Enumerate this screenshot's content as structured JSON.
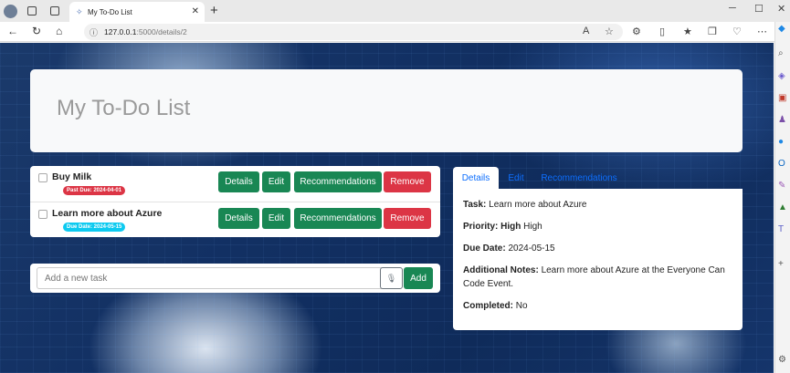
{
  "browser": {
    "tab_title": "My To-Do List",
    "url_host": "127.0.0.1",
    "url_path": ":5000/details/2"
  },
  "app": {
    "title": "My To-Do List"
  },
  "tasks": [
    {
      "title": "Buy Milk",
      "badge": "Past Due: 2024-04-01",
      "badge_color": "#dc3545",
      "completed": false
    },
    {
      "title": "Learn more about Azure",
      "badge": "Due Date: 2024-05-15",
      "badge_color": "#0dcaf0",
      "completed": false
    }
  ],
  "task_actions": {
    "details": "Details",
    "edit": "Edit",
    "recommendations": "Recommendations",
    "remove": "Remove"
  },
  "new_task": {
    "placeholder": "Add a new task",
    "add_label": "Add"
  },
  "detail_tabs": [
    "Details",
    "Edit",
    "Recommendations"
  ],
  "details": {
    "task_label": "Task:",
    "task_value": "Learn more about Azure",
    "priority_label": "Priority:",
    "priority_strong": "High",
    "priority_value": "High",
    "due_label": "Due Date:",
    "due_value": "2024-05-15",
    "notes_label": "Additional Notes:",
    "notes_value": "Learn more about Azure at the Everyone Can Code Event.",
    "completed_label": "Completed:",
    "completed_value": "No"
  },
  "colors": {
    "primary_button": "#198754",
    "danger_button": "#dc3545",
    "link_blue": "#0d6efd"
  }
}
